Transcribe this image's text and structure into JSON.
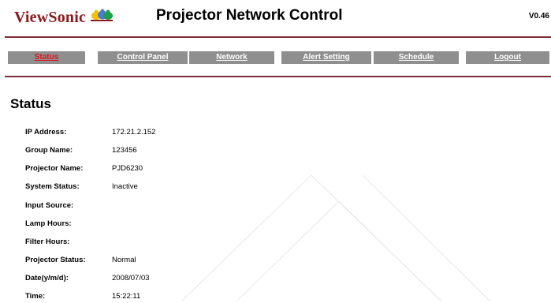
{
  "header": {
    "logo_text": "ViewSonic",
    "title": "Projector Network Control",
    "version": "V0.46"
  },
  "nav": {
    "tabs": [
      {
        "label": "Status",
        "active": true
      },
      {
        "label": "Control Panel",
        "active": false
      },
      {
        "label": "Network",
        "active": false
      },
      {
        "label": "Alert Setting",
        "active": false
      },
      {
        "label": "Schedule",
        "active": false
      },
      {
        "label": "Logout",
        "active": false
      }
    ]
  },
  "main": {
    "heading": "Status",
    "rows": [
      {
        "label": "IP Address:",
        "value": "172.21.2.152"
      },
      {
        "label": "Group Name:",
        "value": "123456"
      },
      {
        "label": "Projector Name:",
        "value": "PJD6230"
      },
      {
        "label": "System Status:",
        "value": "Inactive"
      },
      {
        "label": "Input Source:",
        "value": ""
      },
      {
        "label": "Lamp Hours:",
        "value": ""
      },
      {
        "label": "Filter Hours:",
        "value": ""
      },
      {
        "label": "Projector Status:",
        "value": "Normal"
      },
      {
        "label": "Date(y/m/d):",
        "value": "2008/07/03"
      },
      {
        "label": "Time:",
        "value": "15:22:11"
      }
    ]
  },
  "colors": {
    "brand": "#8a1b20",
    "rule": "#7a2f3a",
    "tab_bg": "#8f8f8f",
    "tab_active_text": "#e0141a"
  }
}
